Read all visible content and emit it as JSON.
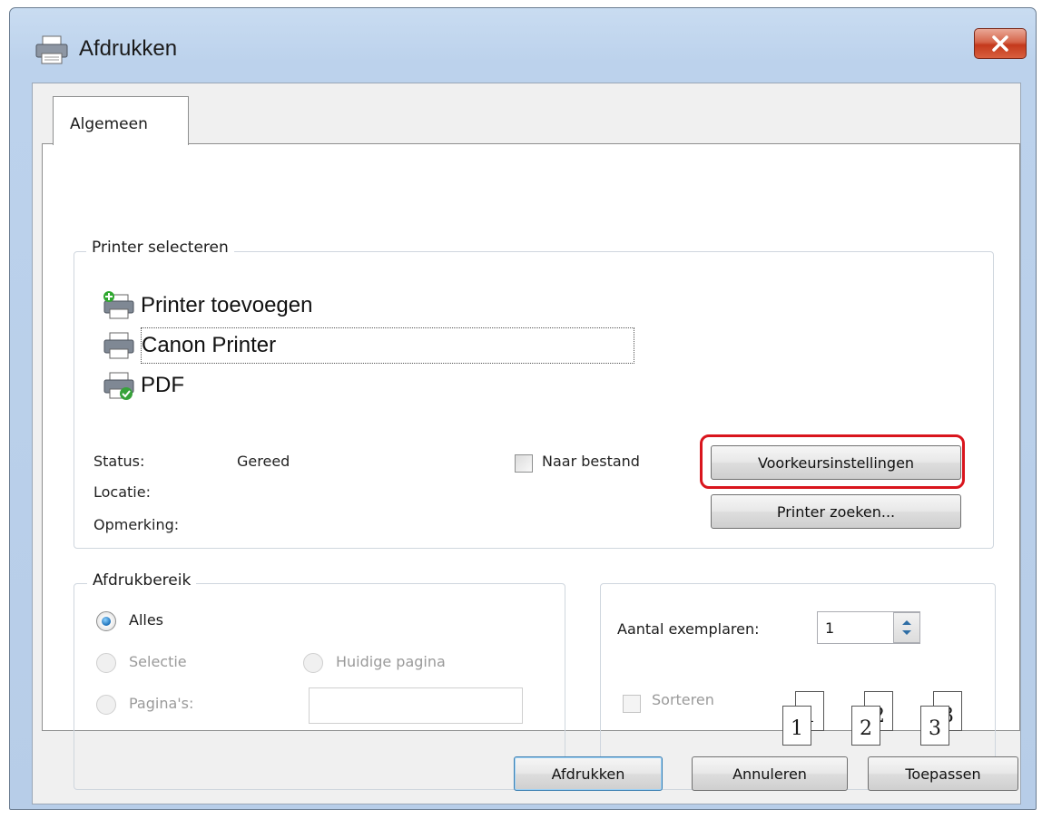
{
  "window": {
    "title": "Afdrukken",
    "close_label": "×"
  },
  "tabs": [
    {
      "label": "Algemeen"
    }
  ],
  "printer_group": {
    "title": "Printer selecteren",
    "printers": [
      {
        "label": "Printer toevoegen",
        "icon": "add-printer-icon"
      },
      {
        "label": "Canon Printer",
        "icon": "printer-icon",
        "selected": true
      },
      {
        "label": "PDF",
        "icon": "pdf-printer-icon"
      }
    ],
    "status_label": "Status:",
    "status_value": "Gereed",
    "location_label": "Locatie:",
    "location_value": "",
    "comment_label": "Opmerking:",
    "comment_value": "",
    "to_file_label": "Naar bestand",
    "preferences_label": "Voorkeursinstellingen",
    "find_printer_label": "Printer zoeken..."
  },
  "range_group": {
    "title": "Afdrukbereik",
    "all_label": "Alles",
    "selection_label": "Selectie",
    "current_page_label": "Huidige pagina",
    "pages_label": "Pagina's:",
    "pages_value": ""
  },
  "copies_group": {
    "copies_label": "Aantal exemplaren:",
    "copies_value": "1",
    "collate_label": "Sorteren",
    "collate_pages": [
      "1",
      "1",
      "2",
      "2",
      "3",
      "3"
    ]
  },
  "buttons": {
    "print": "Afdrukken",
    "cancel": "Annuleren",
    "apply": "Toepassen"
  },
  "colors": {
    "highlight": "#d9151d",
    "titlebar": "#c9dcf1",
    "close_button": "#c4391c"
  }
}
